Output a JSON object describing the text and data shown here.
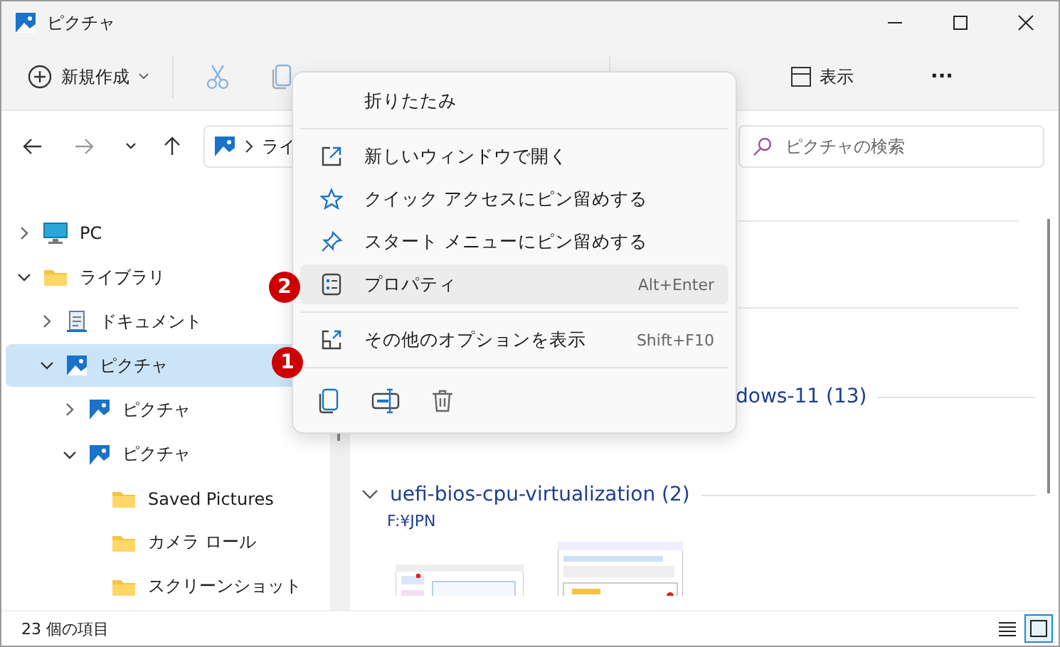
{
  "window": {
    "title": "ピクチャ"
  },
  "toolbar": {
    "items": [
      {
        "kind": "new",
        "label": "新規作成"
      },
      {
        "kind": "cut"
      },
      {
        "kind": "copy"
      },
      {
        "kind": "view",
        "label": "表示"
      },
      {
        "kind": "more",
        "label": "···"
      }
    ]
  },
  "address": {
    "segments": [
      "ライ"
    ],
    "search_placeholder": "ピクチャの検索"
  },
  "sidebar": {
    "items": [
      {
        "label": "PC",
        "kind": "pc",
        "expanded": false,
        "selected": false
      },
      {
        "label": "ライブラリ",
        "kind": "folder",
        "expanded": true,
        "selected": false,
        "children": [
          {
            "label": "ドキュメント",
            "kind": "doc",
            "expanded": false,
            "selected": false
          },
          {
            "label": "ピクチャ",
            "kind": "pictures",
            "expanded": true,
            "selected": true,
            "badge": "1",
            "children": [
              {
                "label": "ピクチャ",
                "kind": "pictures",
                "expanded": false,
                "selected": false
              },
              {
                "label": "ピクチャ",
                "kind": "pictures",
                "expanded": true,
                "selected": false,
                "children": [
                  {
                    "label": "Saved Pictures",
                    "kind": "folder",
                    "selected": false
                  },
                  {
                    "label": "カメラ ロール",
                    "kind": "folder",
                    "selected": false
                  },
                  {
                    "label": "スクリーンショット",
                    "kind": "folder",
                    "selected": false
                  }
                ]
              }
            ]
          }
        ]
      }
    ]
  },
  "content": {
    "groups": [
      {
        "title": "dows-11 (13)"
      },
      {
        "title": "uefi-bios-cpu-virtualization (2)",
        "subtitle": "F:¥JPN"
      }
    ]
  },
  "context_menu": {
    "items": [
      {
        "kind": "plain",
        "label": "折りたたみ",
        "selected": false
      },
      {
        "kind": "separator"
      },
      {
        "kind": "open-new",
        "label": "新しいウィンドウで開く",
        "selected": false
      },
      {
        "kind": "star",
        "label": "クイック アクセスにピン留めする",
        "selected": false
      },
      {
        "kind": "pin",
        "label": "スタート メニューにピン留めする",
        "selected": false
      },
      {
        "kind": "properties",
        "label": "プロパティ",
        "shortcut": "Alt+Enter",
        "selected": true,
        "badge": "2"
      },
      {
        "kind": "separator"
      },
      {
        "kind": "more-options",
        "label": "その他のオプションを表示",
        "shortcut": "Shift+F10",
        "selected": false
      },
      {
        "kind": "separator"
      },
      {
        "kind": "icons",
        "buttons": [
          {
            "kind": "copy"
          },
          {
            "kind": "rename"
          },
          {
            "kind": "delete"
          }
        ]
      }
    ]
  },
  "status_bar": {
    "text": "23 個の項目",
    "views": [
      {
        "kind": "details",
        "selected": false
      },
      {
        "kind": "large-icons",
        "selected": true
      }
    ]
  }
}
